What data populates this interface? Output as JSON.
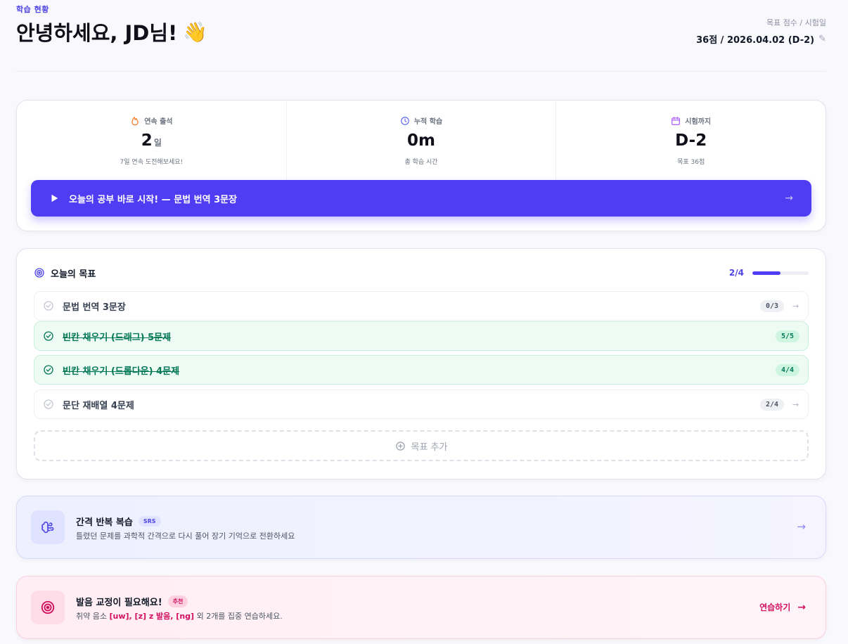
{
  "header": {
    "eyebrow": "학습 현황",
    "greeting": "안녕하세요, JD님!",
    "greeting_emoji": "👋",
    "target_label": "목표 점수 / 시험일",
    "target_value": "36점 / 2026.04.02 (D-2)"
  },
  "stats": [
    {
      "label": "연속 출석",
      "value": "2",
      "unit": "일",
      "sub": "7일 연속 도전해보세요!",
      "icon": "flame-icon",
      "color": "#f97316"
    },
    {
      "label": "누적 학습",
      "value": "0m",
      "sub": "총 학습 시간",
      "icon": "clock-icon",
      "color": "#6366f1"
    },
    {
      "label": "시험까지",
      "value": "D-2",
      "sub": "목표 36점",
      "icon": "calendar-icon",
      "color": "#a855f7"
    }
  ],
  "start_button": {
    "label": "오늘의 공부 바로 시작! — 문법 번역 3문장"
  },
  "goals": {
    "title": "오늘의 목표",
    "count": "2/4",
    "progress": 0.5,
    "items": [
      {
        "text": "문법 번역 3문장",
        "badge": "0/3",
        "done": false
      },
      {
        "text": "빈칸 채우기 (드래그) 5문제",
        "badge": "5/5",
        "done": true
      },
      {
        "text": "빈칸 채우기 (드롭다운) 4문제",
        "badge": "4/4",
        "done": true
      },
      {
        "text": "문단 재배열 4문제",
        "badge": "2/4",
        "done": false
      }
    ],
    "add_label": "목표 추가"
  },
  "srs": {
    "title": "간격 반복 복습",
    "tag": "SRS",
    "desc": "틀렸던 문제를 과학적 간격으로 다시 풀어 장기 기억으로 전환하세요"
  },
  "pronunciation": {
    "title": "발음 교정이 필요해요!",
    "tag": "추천",
    "desc_prefix": "취약 음소 ",
    "desc_highlight": "[uw], [z] z 발음, [ng]",
    "desc_suffix": " 외 2개를 집중 연습하세요.",
    "action": "연습하기"
  },
  "colors": {
    "accent": "#4f3df3",
    "success": "#047857",
    "pink": "#d10f5f"
  }
}
